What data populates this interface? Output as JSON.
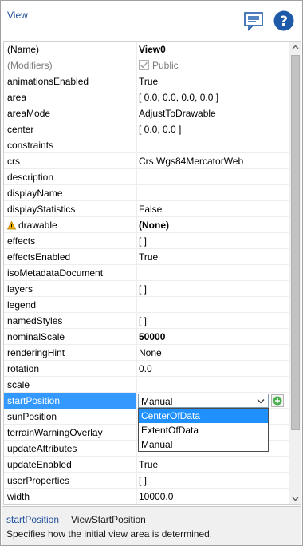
{
  "header": {
    "title": "View",
    "comment_icon": "comment-icon",
    "help_icon": "help-icon"
  },
  "properties": [
    {
      "name": "(Name)",
      "value": "View0",
      "bold": true
    },
    {
      "name": "(Modifiers)",
      "value": "Public",
      "checkbox": true,
      "disabled": true
    },
    {
      "name": "animationsEnabled",
      "value": "True"
    },
    {
      "name": "area",
      "value": "[ 0.0, 0.0, 0.0, 0.0 ]"
    },
    {
      "name": "areaMode",
      "value": "AdjustToDrawable"
    },
    {
      "name": "center",
      "value": "[ 0.0, 0.0 ]"
    },
    {
      "name": "constraints",
      "value": ""
    },
    {
      "name": "crs",
      "value": "Crs.Wgs84MercatorWeb"
    },
    {
      "name": "description",
      "value": ""
    },
    {
      "name": "displayName",
      "value": ""
    },
    {
      "name": "displayStatistics",
      "value": "False"
    },
    {
      "name": "drawable",
      "value": "(None)",
      "bold": true,
      "warning": true
    },
    {
      "name": "effects",
      "value": "[ ]"
    },
    {
      "name": "effectsEnabled",
      "value": "True"
    },
    {
      "name": "isoMetadataDocument",
      "value": ""
    },
    {
      "name": "layers",
      "value": "[ ]"
    },
    {
      "name": "legend",
      "value": ""
    },
    {
      "name": "namedStyles",
      "value": "[ ]"
    },
    {
      "name": "nominalScale",
      "value": "50000",
      "bold": true
    },
    {
      "name": "renderingHint",
      "value": "None"
    },
    {
      "name": "rotation",
      "value": "0.0"
    },
    {
      "name": "scale",
      "value": ""
    },
    {
      "name": "startPosition",
      "value": "Manual",
      "selected": true,
      "combo": true
    },
    {
      "name": "sunPosition",
      "value": ""
    },
    {
      "name": "terrainWarningOverlay",
      "value": ""
    },
    {
      "name": "updateAttributes",
      "value": ""
    },
    {
      "name": "updateEnabled",
      "value": "True"
    },
    {
      "name": "userProperties",
      "value": "[ ]"
    },
    {
      "name": "width",
      "value": "10000.0"
    }
  ],
  "dropdown": {
    "options": [
      "CenterOfData",
      "ExtentOfData",
      "Manual"
    ],
    "highlighted_index": 0
  },
  "description": {
    "property": "startPosition",
    "type": "ViewStartPosition",
    "text": "Specifies how the initial view area is determined."
  },
  "colors": {
    "selection": "#3399ff",
    "dropdown_highlight": "#1e90ff",
    "link": "#1f4e9b",
    "help": "#1e5aa8",
    "add_button": "#4caf50"
  }
}
